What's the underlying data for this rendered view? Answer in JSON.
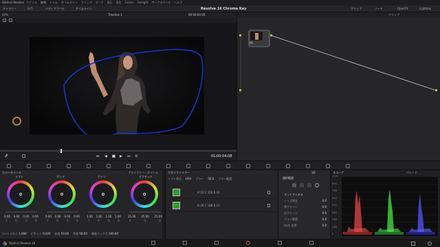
{
  "app": {
    "title_left": "DaVinci Resolve",
    "project_title": "Resolve 16 Chroma Key",
    "menu": [
      "ファイル",
      "編集",
      "トリム",
      "タイムライン",
      "クリップ",
      "マーク",
      "表示",
      "再生",
      "Fusion",
      "Fairlight",
      "ワークスペース",
      "ヘルプ"
    ],
    "bottom_label": "DaVinci Resolve 16"
  },
  "toolbar": {
    "zoom": "40%",
    "items": [
      "ギャラリー",
      "LUT",
      "メディアプール",
      "タイムライン"
    ],
    "timeline_name": "Timeline 1",
    "timecode_top": "00:00:04:05",
    "clip_btn": "クリップ",
    "nodes_btn": "ノード",
    "openfx_btn": "OpenFX",
    "lightbox_btn": "Lightbox",
    "clip_dropdown": "クリップ"
  },
  "viewer": {
    "timecode": "01:00:04:08"
  },
  "color_wheels": {
    "title": "カラーホイール",
    "mode": "プライマリー・ホイール",
    "wheels": [
      {
        "name": "リフト",
        "values": [
          "0.00",
          "0.00",
          "0.00",
          "0.00"
        ],
        "channels": [
          "Y",
          "R",
          "G",
          "B"
        ],
        "ring": "#6a6a6a"
      },
      {
        "name": "ガンマ",
        "values": [
          "0.00",
          "0.00",
          "0.00",
          "0.00"
        ],
        "channels": [
          "Y",
          "R",
          "G",
          "B"
        ],
        "ring": "#6a6a6a"
      },
      {
        "name": "ゲイン",
        "values": [
          "1.00",
          "1.00",
          "1.00",
          "1.00"
        ],
        "channels": [
          "Y",
          "R",
          "G",
          "B"
        ],
        "ring": "#6a6a6a"
      },
      {
        "name": "オフセット",
        "values": [
          "25.00",
          "25.00",
          "25.00"
        ],
        "channels": [
          "R",
          "G",
          "B"
        ],
        "ring": "#6a6a6a"
      }
    ],
    "footer": [
      {
        "label": "コントラスト",
        "value": "1.000"
      },
      {
        "label": "ピボット",
        "value": "0.435"
      },
      {
        "label": "彩度",
        "value": "50.00"
      },
      {
        "label": "色相",
        "value": "50.00"
      },
      {
        "label": "輝度ミックス",
        "value": "100.00"
      }
    ]
  },
  "qualifier": {
    "title": "クオリファイアー",
    "options": [
      "ソフト表示",
      "HSV",
      "ブラー",
      "50.0",
      "ブラー範囲"
    ],
    "colorspace": "HSV",
    "picks": [
      {
        "h": "H 22",
        "s": "C 156",
        "v": "B 20"
      },
      {
        "h": "H 20",
        "s": "C 148",
        "v": "B 17"
      }
    ]
  },
  "matte": {
    "title": "選択範囲",
    "section": "マットフィネス",
    "rows": [
      {
        "label": "ノイズ除去",
        "value": "0.0"
      },
      {
        "label": "黒クリーン",
        "value": "0.0"
      },
      {
        "label": "白クリーン",
        "value": "0.0"
      },
      {
        "label": "ブラー範囲",
        "value": "0.0"
      },
      {
        "label": "内/外 比率",
        "value": "0.0"
      }
    ],
    "mode_3d": "3D"
  },
  "scopes": {
    "title": "スコープ",
    "mode": "パレード",
    "ticks": [
      "1023",
      "896",
      "768",
      "640",
      "512",
      "384",
      "256",
      "128",
      "0"
    ]
  },
  "node": {
    "label": "01"
  }
}
